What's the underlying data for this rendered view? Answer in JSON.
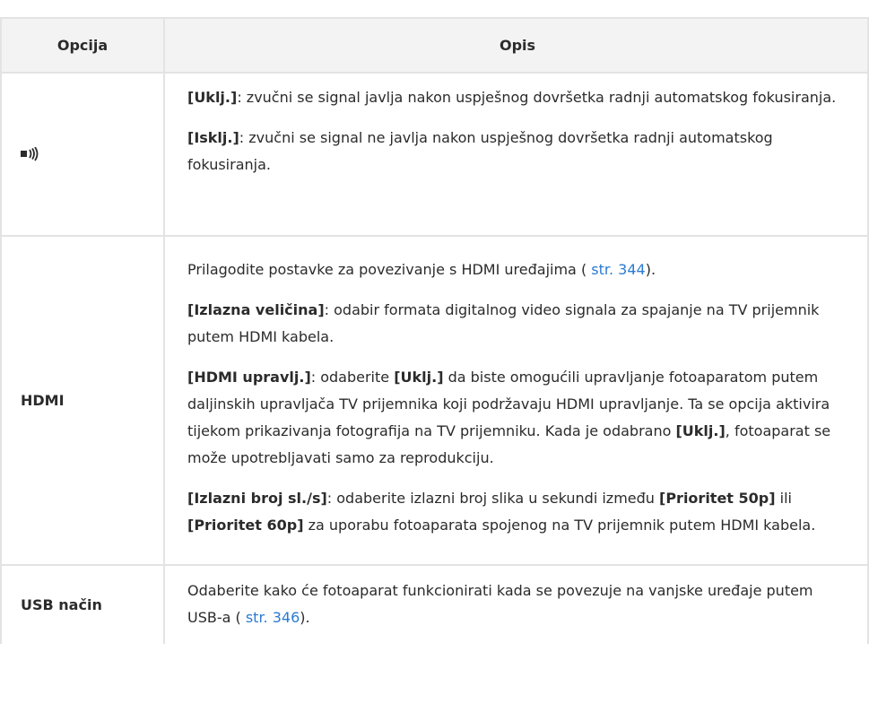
{
  "header": {
    "col1": "Opcija",
    "col2": "Opis"
  },
  "rows": [
    {
      "option_icon": "sound-beep-icon",
      "paragraphs": [
        {
          "bold": "[Uklj.]",
          "text": ": zvučni se signal javlja nakon uspješnog dovršetka radnji automatskog fokusiranja."
        },
        {
          "bold": "[Isklj.]",
          "text": ": zvučni se signal ne javlja nakon uspješnog dovršetka radnji automatskog fokusiranja."
        }
      ]
    },
    {
      "option": "HDMI",
      "intro_pre": "Prilagodite postavke za povezivanje s HDMI uređajima (",
      "intro_link": " str. 344",
      "intro_post": ").",
      "p1_bold": "[Izlazna veličina]",
      "p1_text": ": odabir formata digitalnog video signala za spajanje na TV prijemnik putem HDMI kabela.",
      "p2_bold": "[HDMI upravlj.]",
      "p2_text_a": ": odaberite ",
      "p2_bold2": "[Uklj.]",
      "p2_text_b": " da biste omogućili upravljanje fotoaparatom putem daljinskih upravljača TV prijemnika koji podržavaju HDMI upravljanje. Ta se opcija aktivira tijekom prikazivanja fotografija na TV prijemniku. Kada je odabrano ",
      "p2_bold3": "[Uklj.]",
      "p2_text_c": ", fotoaparat se može upotrebljavati samo za reprodukciju.",
      "p3_bold": "[Izlazni broj sl./s]",
      "p3_text_a": ": odaberite izlazni broj slika u sekundi između ",
      "p3_bold2": "[Prioritet 50p]",
      "p3_text_b": " ili ",
      "p3_bold3": "[Prioritet 60p]",
      "p3_text_c": " za uporabu fotoaparata spojenog na TV prijemnik putem HDMI kabela."
    },
    {
      "option": "USB način",
      "text_pre": "Odaberite kako će fotoaparat funkcionirati kada se povezuje na vanjske uređaje putem USB-a (",
      "link": " str. 346",
      "text_post": ")."
    }
  ],
  "colors": {
    "link": "#2a7ad3",
    "header_bg": "#f3f3f3",
    "border": "#e3e3e3"
  }
}
